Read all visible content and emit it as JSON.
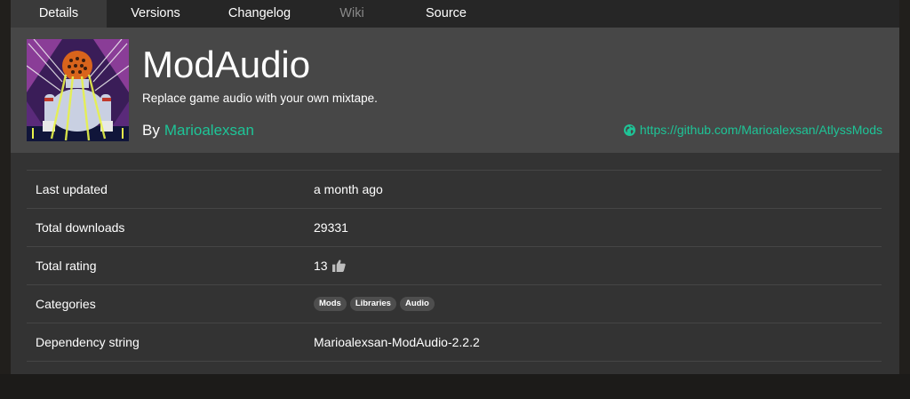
{
  "tabs": [
    {
      "label": "Details",
      "active": true
    },
    {
      "label": "Versions"
    },
    {
      "label": "Changelog"
    },
    {
      "label": "Wiki",
      "disabled": true
    },
    {
      "label": "Source"
    }
  ],
  "header": {
    "title": "ModAudio",
    "description": "Replace game audio with your own mixtape.",
    "by_label": "By",
    "author": "Marioalexsan",
    "website": "https://github.com/Marioalexsan/AtlyssMods"
  },
  "details": {
    "last_updated": {
      "label": "Last updated",
      "value": "a month ago"
    },
    "total_downloads": {
      "label": "Total downloads",
      "value": "29331"
    },
    "total_rating": {
      "label": "Total rating",
      "value": "13"
    },
    "categories": {
      "label": "Categories",
      "items": [
        "Mods",
        "Libraries",
        "Audio"
      ]
    },
    "dependency_string": {
      "label": "Dependency string",
      "value": "Marioalexsan-ModAudio-2.2.2"
    }
  },
  "colors": {
    "accent": "#1ec497",
    "header_bg": "#474747",
    "content_bg": "#333333",
    "tab_active_bg": "#3a3a3a"
  },
  "icons": {
    "website": "globe-icon",
    "rating": "thumbs-up-icon"
  }
}
